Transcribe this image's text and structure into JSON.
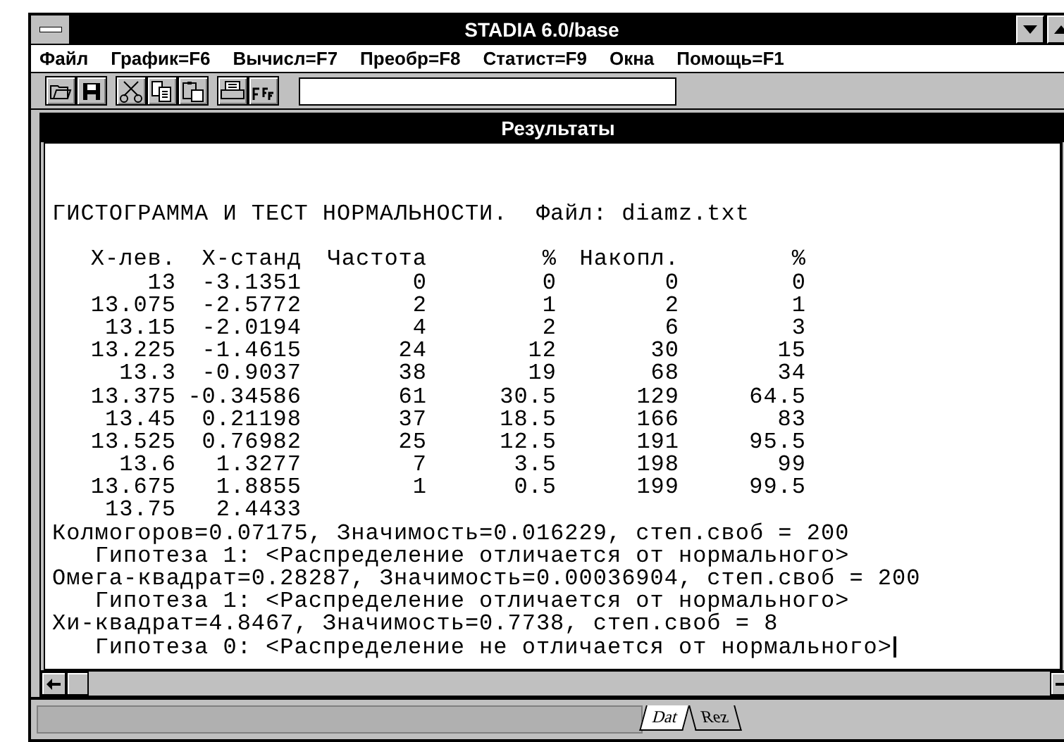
{
  "window": {
    "title": "STADIA 6.0/base"
  },
  "menu": [
    "Файл",
    "График=F6",
    "Вычисл=F7",
    "Преобр=F8",
    "Статист=F9",
    "Окна",
    "Помощь=F1"
  ],
  "toolbar": {
    "buttons": [
      {
        "kind": "open"
      },
      {
        "kind": "save"
      },
      {
        "kind": "cut"
      },
      {
        "kind": "copy"
      },
      {
        "kind": "paste"
      },
      {
        "kind": "print"
      },
      {
        "kind": "font"
      }
    ]
  },
  "results": {
    "title": "Результаты",
    "heading": "ГИСТОГРАММА И ТЕСТ НОРМАЛЬНОСТИ.",
    "file": "Файл: diamz.txt",
    "columns": [
      "X-лев.",
      "X-станд",
      "Частота",
      "%",
      "Накопл.",
      "%"
    ],
    "rows": [
      [
        "13",
        "-3.1351",
        "0",
        "0",
        "0",
        "0"
      ],
      [
        "13.075",
        "-2.5772",
        "2",
        "1",
        "2",
        "1"
      ],
      [
        "13.15",
        "-2.0194",
        "4",
        "2",
        "6",
        "3"
      ],
      [
        "13.225",
        "-1.4615",
        "24",
        "12",
        "30",
        "15"
      ],
      [
        "13.3",
        "-0.9037",
        "38",
        "19",
        "68",
        "34"
      ],
      [
        "13.375",
        "-0.34586",
        "61",
        "30.5",
        "129",
        "64.5"
      ],
      [
        "13.45",
        "0.21198",
        "37",
        "18.5",
        "166",
        "83"
      ],
      [
        "13.525",
        "0.76982",
        "25",
        "12.5",
        "191",
        "95.5"
      ],
      [
        "13.6",
        "1.3277",
        "7",
        "3.5",
        "198",
        "99"
      ],
      [
        "13.675",
        "1.8855",
        "1",
        "0.5",
        "199",
        "99.5"
      ],
      [
        "13.75",
        "2.4433"
      ]
    ],
    "tests": [
      {
        "kind": "stat",
        "text": "Колмогоров=0.07175, Значимость=0.016229, степ.своб = 200"
      },
      {
        "kind": "hypothesis",
        "text": "Гипотеза 1: <Распределение отличается от нормального>"
      },
      {
        "kind": "stat",
        "text": "Омега-квадрат=0.28287, Значимость=0.00036904, степ.своб = 200"
      },
      {
        "kind": "hypothesis",
        "text": "Гипотеза 1: <Распределение отличается от нормального>"
      },
      {
        "kind": "stat",
        "text": "Хи-квадрат=4.8467, Значимость=0.7738, степ.своб = 8"
      },
      {
        "kind": "hypothesis",
        "text": "Гипотеза 0: <Распределение не отличается от нормального>"
      }
    ]
  },
  "sheet_tabs": [
    {
      "label": "Dat",
      "selected": true
    },
    {
      "label": "Rez",
      "selected": false
    }
  ]
}
